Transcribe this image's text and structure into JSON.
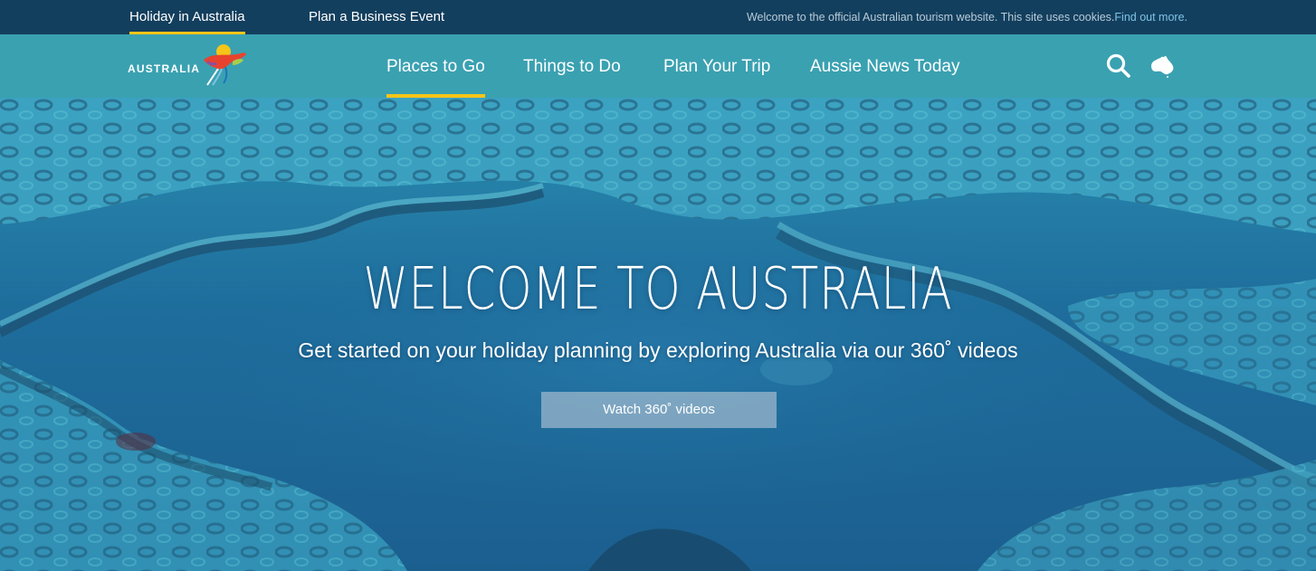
{
  "topbar": {
    "tabs": [
      {
        "label": "Holiday in Australia"
      },
      {
        "label": "Plan a Business Event"
      }
    ],
    "cookie_text": "Welcome to the official Australian tourism website. This site uses cookies.",
    "cookie_link": "Find out more."
  },
  "brand": {
    "logo_text": "AUSTRALIA",
    "accent_color": "#f5c518",
    "nav_color": "#3aa1b1",
    "topbar_color": "#133f5e"
  },
  "nav": {
    "items": [
      {
        "label": "Places to Go",
        "active": true
      },
      {
        "label": "Things to Do"
      },
      {
        "label": "Plan Your Trip"
      },
      {
        "label": "Aussie News Today"
      }
    ],
    "icons": [
      "search-icon",
      "australia-map-icon"
    ]
  },
  "hero": {
    "title": "WELCOME TO AUSTRALIA",
    "subtitle": "Get started on your holiday planning by exploring Australia via our 360˚ videos",
    "button_label": "Watch 360˚ videos"
  }
}
